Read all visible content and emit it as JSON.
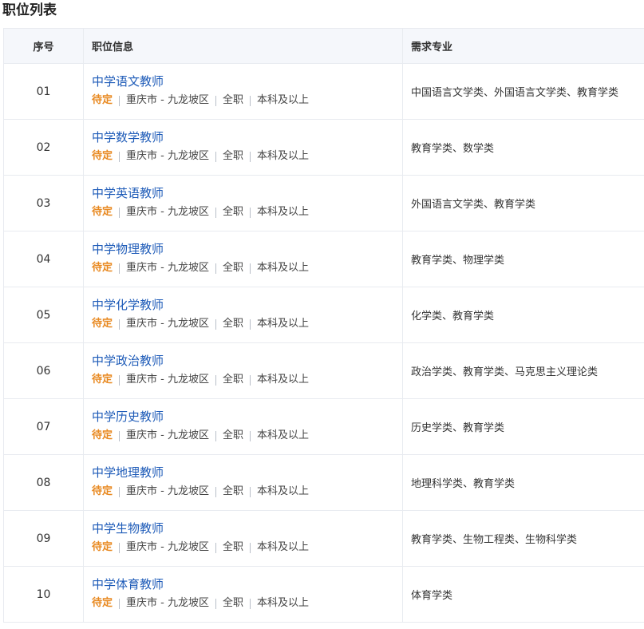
{
  "page": {
    "title": "职位列表"
  },
  "table": {
    "headers": {
      "index": "序号",
      "info": "职位信息",
      "major": "需求专业"
    },
    "rows": [
      {
        "index": "01",
        "title": "中学语文教师",
        "status": "待定",
        "location": "重庆市 - 九龙坡区",
        "type": "全职",
        "education": "本科及以上",
        "major": "中国语言文学类、外国语言文学类、教育学类"
      },
      {
        "index": "02",
        "title": "中学数学教师",
        "status": "待定",
        "location": "重庆市 - 九龙坡区",
        "type": "全职",
        "education": "本科及以上",
        "major": "教育学类、数学类"
      },
      {
        "index": "03",
        "title": "中学英语教师",
        "status": "待定",
        "location": "重庆市 - 九龙坡区",
        "type": "全职",
        "education": "本科及以上",
        "major": "外国语言文学类、教育学类"
      },
      {
        "index": "04",
        "title": "中学物理教师",
        "status": "待定",
        "location": "重庆市 - 九龙坡区",
        "type": "全职",
        "education": "本科及以上",
        "major": "教育学类、物理学类"
      },
      {
        "index": "05",
        "title": "中学化学教师",
        "status": "待定",
        "location": "重庆市 - 九龙坡区",
        "type": "全职",
        "education": "本科及以上",
        "major": "化学类、教育学类"
      },
      {
        "index": "06",
        "title": "中学政治教师",
        "status": "待定",
        "location": "重庆市 - 九龙坡区",
        "type": "全职",
        "education": "本科及以上",
        "major": "政治学类、教育学类、马克思主义理论类"
      },
      {
        "index": "07",
        "title": "中学历史教师",
        "status": "待定",
        "location": "重庆市 - 九龙坡区",
        "type": "全职",
        "education": "本科及以上",
        "major": "历史学类、教育学类"
      },
      {
        "index": "08",
        "title": "中学地理教师",
        "status": "待定",
        "location": "重庆市 - 九龙坡区",
        "type": "全职",
        "education": "本科及以上",
        "major": "地理科学类、教育学类"
      },
      {
        "index": "09",
        "title": "中学生物教师",
        "status": "待定",
        "location": "重庆市 - 九龙坡区",
        "type": "全职",
        "education": "本科及以上",
        "major": "教育学类、生物工程类、生物科学类"
      },
      {
        "index": "10",
        "title": "中学体育教师",
        "status": "待定",
        "location": "重庆市 - 九龙坡区",
        "type": "全职",
        "education": "本科及以上",
        "major": "体育学类"
      }
    ]
  }
}
